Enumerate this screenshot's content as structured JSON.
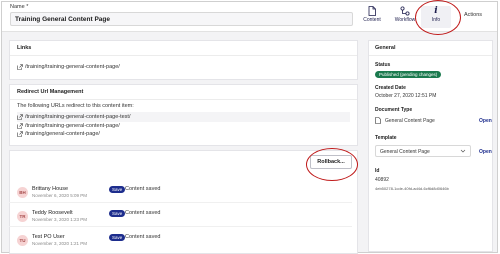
{
  "header": {
    "name_label": "Name *",
    "name_value": "Training General Content Page",
    "apps": {
      "content": "Content",
      "workflow": "Workflow",
      "info": "Info"
    },
    "actions_label": "Actions"
  },
  "links_panel": {
    "title": "Links",
    "items": [
      "/training/training-general-content-page/"
    ]
  },
  "redirect_panel": {
    "title": "Redirect Url Management",
    "description": "The following URLs redirect to this content item:",
    "items": [
      "/training/training-general-content-page-test/",
      "/training/training-general-content-page/",
      "/training/general-content-page/"
    ]
  },
  "history": {
    "rollback_label": "Rollback...",
    "items": [
      {
        "initials": "BH",
        "name": "Brittany House",
        "date": "November 6, 2020 5:09 PM",
        "badge": "Save",
        "text": "Content saved"
      },
      {
        "initials": "TR",
        "name": "Teddy Roosevelt",
        "date": "November 3, 2020 1:23 PM",
        "badge": "Save",
        "text": "Content saved"
      },
      {
        "initials": "TU",
        "name": "Test PO User",
        "date": "November 3, 2020 1:21 PM",
        "badge": "Save",
        "text": "Content saved"
      }
    ]
  },
  "general": {
    "title": "General",
    "status_label": "Status",
    "status_value": "Published (pending changes)",
    "created_label": "Created Date",
    "created_value": "October 27, 2020 12:51 PM",
    "doctype_label": "Document Type",
    "doctype_value": "General Content Page",
    "doctype_open": "Open",
    "template_label": "Template",
    "template_value": "General Content Page",
    "template_open": "Open",
    "id_label": "Id",
    "id_value": "40892",
    "guid_value": "4eb50278-1cde-40fd-ad4d-6cf6d8d0646b"
  },
  "colors": {
    "accent": "#1d2d8d",
    "status_green": "#1b7a4e",
    "highlight_circle": "#c01a1a",
    "avatar_bg": "#f6d3d3"
  }
}
